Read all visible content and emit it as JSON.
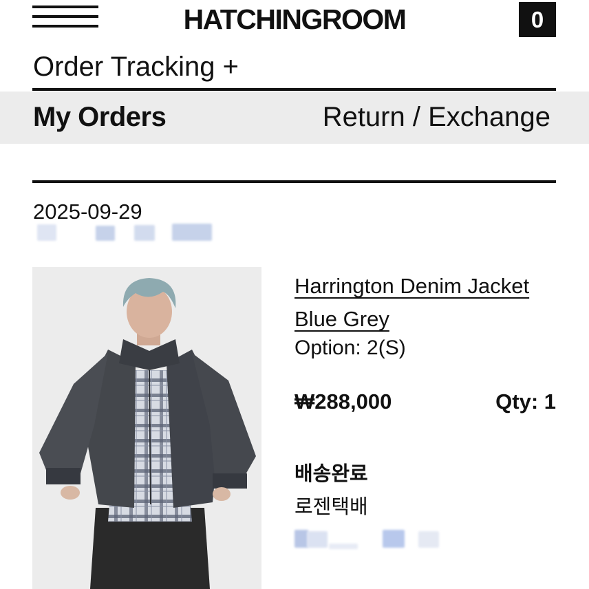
{
  "header": {
    "brand": "HATCHINGROOM",
    "cart_count": "0",
    "menu_icon": "hamburger-menu-icon"
  },
  "page": {
    "title": "Order Tracking +"
  },
  "tabs": {
    "active": "My Orders",
    "other": "Return / Exchange"
  },
  "order": {
    "date": "2025-09-29",
    "item": {
      "name": "Harrington Denim Jacket Blue Grey",
      "option": "Option: 2(S)",
      "price": "₩288,000",
      "qty": "Qty: 1",
      "status": "배송완료",
      "carrier": "로젠택배"
    }
  },
  "colors": {
    "text": "#111111",
    "tab_background": "#ececec",
    "redaction": "#c6d2ea"
  }
}
